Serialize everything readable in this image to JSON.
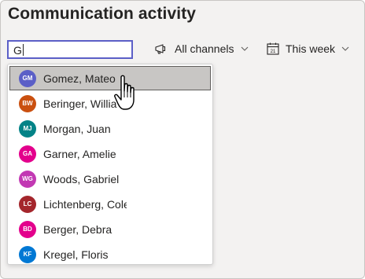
{
  "header": {
    "title": "Communication activity"
  },
  "search": {
    "value": "G"
  },
  "filters": {
    "channels_label": "All channels",
    "date_label": "This week",
    "calendar_day": "21"
  },
  "dropdown": {
    "items": [
      {
        "initials": "GM",
        "name": "Gomez, Mateo",
        "color": "#5b5fc7",
        "selected": true
      },
      {
        "initials": "BW",
        "name": "Beringer, Willia",
        "color": "#ca5010"
      },
      {
        "initials": "MJ",
        "name": "Morgan, Juan",
        "color": "#038387"
      },
      {
        "initials": "GA",
        "name": "Garner, Amelie",
        "color": "#e3008c"
      },
      {
        "initials": "WG",
        "name": "Woods, Gabriel",
        "color": "#c239b3"
      },
      {
        "initials": "LC",
        "name": "Lichtenberg, Colette",
        "color": "#a4262c"
      },
      {
        "initials": "BD",
        "name": "Berger, Debra",
        "color": "#e3008c"
      },
      {
        "initials": "KF",
        "name": "Kregel, Floris",
        "color": "#0078d4"
      }
    ]
  },
  "colors": {
    "accent": "#5b5fc7",
    "selected_bg": "#c8c6c4"
  }
}
